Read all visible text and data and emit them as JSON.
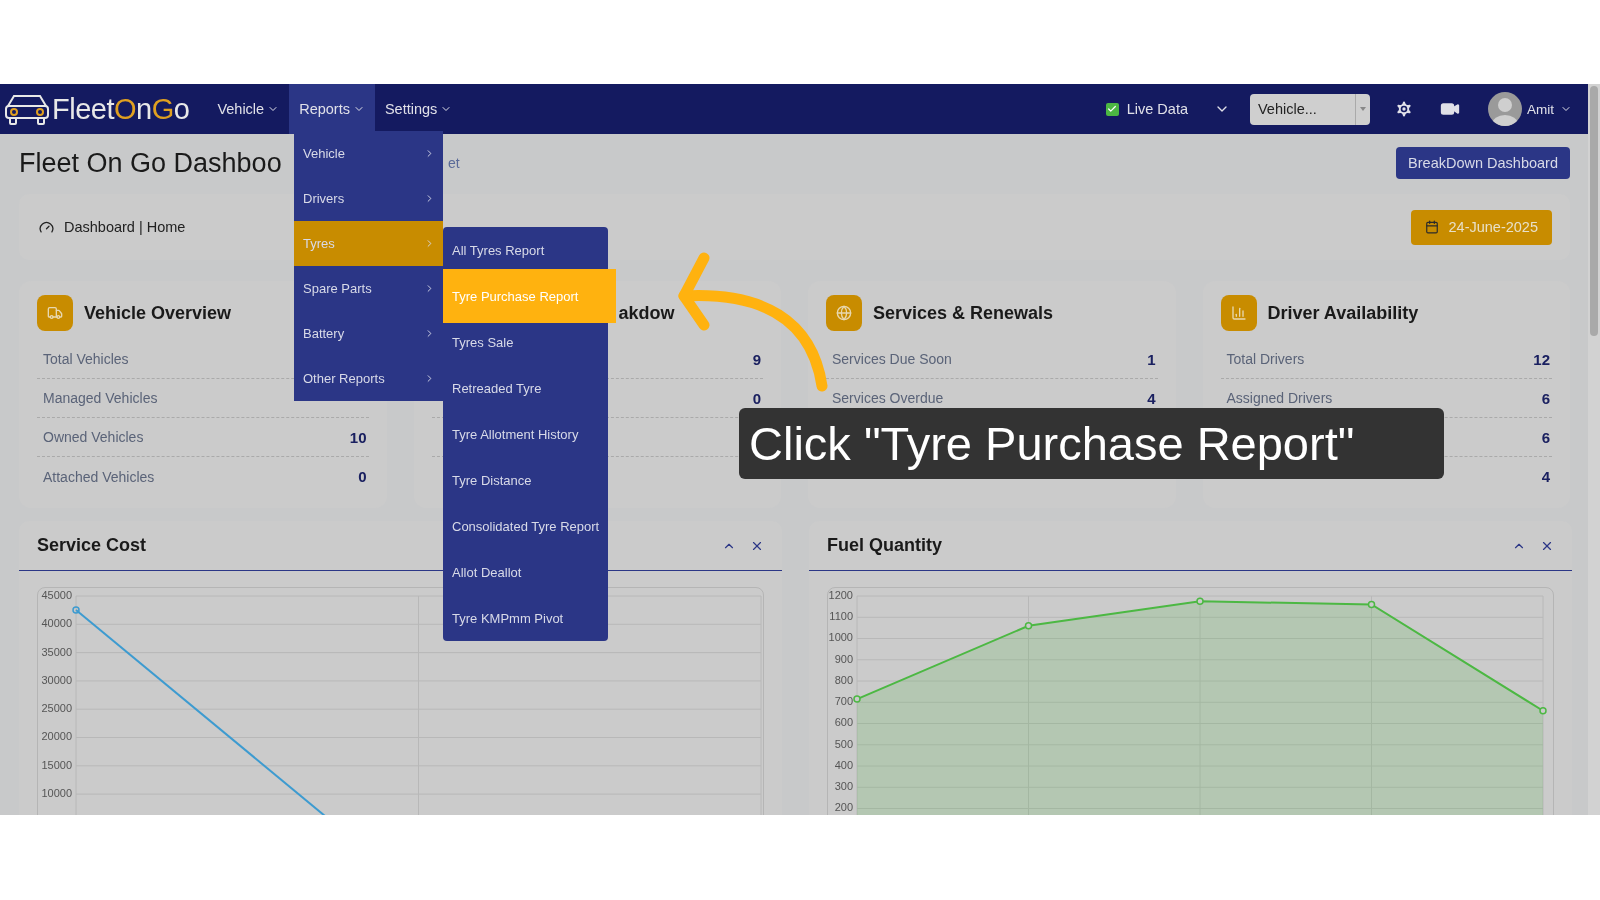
{
  "logo": {
    "parts": [
      {
        "text": "Fleet",
        "accent": false
      },
      {
        "text": "O",
        "accent": true
      },
      {
        "text": "n",
        "accent": false
      },
      {
        "text": "G",
        "accent": true
      },
      {
        "text": "o",
        "accent": false
      }
    ]
  },
  "nav": {
    "items": [
      {
        "label": "Vehicle",
        "selected": false
      },
      {
        "label": "Reports",
        "selected": true
      },
      {
        "label": "Settings",
        "selected": false
      }
    ],
    "live_data": {
      "label": "Live Data",
      "checked": true
    },
    "vehicle_select": {
      "value": "Vehicle..."
    },
    "user": {
      "name": "Amit"
    }
  },
  "header": {
    "title": "Fleet On Go Dashboo",
    "subtitle": "et",
    "button": "BreakDown Dashboard"
  },
  "breadcrumb": {
    "text": "Dashboard | Home",
    "date": "24-June-2025"
  },
  "cards": [
    {
      "title": "Vehicle Overview",
      "covered": false,
      "rows": [
        {
          "label": "Total Vehicles"
        },
        {
          "label": "Managed Vehicles"
        },
        {
          "label": "Owned Vehicles",
          "value": "10"
        },
        {
          "label": "Attached Vehicles",
          "value": "0"
        }
      ]
    },
    {
      "title": "akdow",
      "covered": true,
      "rows": [
        {
          "value": "9"
        },
        {
          "value": "0"
        },
        {},
        {}
      ]
    },
    {
      "title": "Services & Renewals",
      "covered": false,
      "rows": [
        {
          "label": "Services Due Soon",
          "value": "1"
        },
        {
          "label": "Services Overdue",
          "value": "4"
        },
        {},
        {}
      ]
    },
    {
      "title": "Driver Availability",
      "covered": false,
      "rows": [
        {
          "label": "Total Drivers",
          "value": "12"
        },
        {
          "label": "Assigned Drivers",
          "value": "6"
        },
        {
          "value": "6"
        },
        {
          "value": "4"
        }
      ]
    }
  ],
  "panels": [
    {
      "title": "Service Cost",
      "y_labels": [
        "45000",
        "40000",
        "35000",
        "30000",
        "25000",
        "20000",
        "15000",
        "10000"
      ]
    },
    {
      "title": "Fuel Quantity",
      "chart_data": {
        "type": "area",
        "grid": true,
        "categories": [
          null,
          null,
          null,
          null,
          null
        ],
        "series": [
          {
            "color": "#4cb843",
            "marker": "circle",
            "values": [
              715,
              1060,
              1175,
              1160,
              660
            ]
          }
        ],
        "ylim": [
          0,
          1200
        ],
        "yticks": [
          200,
          300,
          400,
          500,
          600,
          700,
          800,
          900,
          1000,
          1100,
          1200
        ]
      }
    }
  ],
  "reports_menu": {
    "items": [
      {
        "label": "Vehicle",
        "selected": false
      },
      {
        "label": "Drivers",
        "selected": false
      },
      {
        "label": "Tyres",
        "selected": true
      },
      {
        "label": "Spare Parts",
        "selected": false
      },
      {
        "label": "Battery",
        "selected": false
      },
      {
        "label": "Other Reports",
        "selected": false
      }
    ]
  },
  "tyres_menu": {
    "items": [
      {
        "label": "All Tyres Report",
        "selected": false
      },
      {
        "label": "Tyre Purchase Report",
        "selected": true
      },
      {
        "label": "Tyres Sale",
        "selected": false
      },
      {
        "label": "Retreaded Tyre",
        "selected": false
      },
      {
        "label": "Tyre Allotment History",
        "selected": false
      },
      {
        "label": "Tyre Distance",
        "selected": false
      },
      {
        "label": "Consolidated Tyre Report",
        "selected": false
      },
      {
        "label": "Allot Deallot",
        "selected": false
      },
      {
        "label": "Tyre KMPmm Pivot",
        "selected": false
      }
    ]
  },
  "tooltip": {
    "text": "Click \"Tyre Purchase Report\""
  }
}
